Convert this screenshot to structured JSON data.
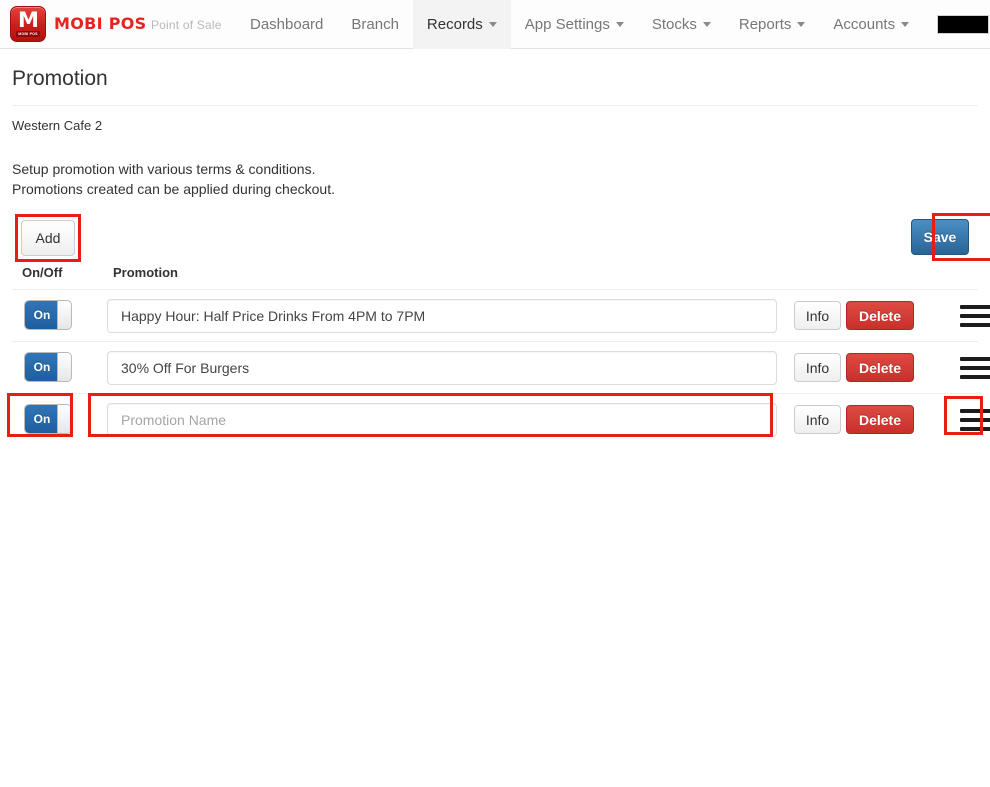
{
  "brand": {
    "logo_glyph": "M",
    "logo_badge": "MOBI POS",
    "title": "MOBI POS",
    "subtitle": "Point of Sale"
  },
  "nav": {
    "items": [
      {
        "label": "Dashboard",
        "has_caret": false,
        "active": false
      },
      {
        "label": "Branch",
        "has_caret": false,
        "active": false
      },
      {
        "label": "Records",
        "has_caret": true,
        "active": true
      },
      {
        "label": "App Settings",
        "has_caret": true,
        "active": false
      },
      {
        "label": "Stocks",
        "has_caret": true,
        "active": false
      },
      {
        "label": "Reports",
        "has_caret": true,
        "active": false
      },
      {
        "label": "Accounts",
        "has_caret": true,
        "active": false
      }
    ],
    "account_label": ""
  },
  "page": {
    "title": "Promotion",
    "branch": "Western Cafe 2",
    "description_line1": "Setup promotion with various terms & conditions.",
    "description_line2": "Promotions created can be applied during checkout."
  },
  "toolbar": {
    "add_label": "Add",
    "save_label": "Save"
  },
  "table": {
    "headers": {
      "onoff": "On/Off",
      "promotion": "Promotion"
    },
    "rows": [
      {
        "toggle_label": "On",
        "toggle_state": "on",
        "value": "Happy Hour: Half Price Drinks From 4PM to 7PM",
        "placeholder": "Promotion Name",
        "info_label": "Info",
        "delete_label": "Delete"
      },
      {
        "toggle_label": "On",
        "toggle_state": "on",
        "value": "30% Off For Burgers",
        "placeholder": "Promotion Name",
        "info_label": "Info",
        "delete_label": "Delete"
      },
      {
        "toggle_label": "On",
        "toggle_state": "on",
        "value": "",
        "placeholder": "Promotion Name",
        "info_label": "Info",
        "delete_label": "Delete"
      }
    ]
  },
  "colors": {
    "brand_red": "#e8231f",
    "primary_blue": "#2a6496",
    "danger_red": "#c9302c",
    "annotation_red": "#e81e12"
  }
}
